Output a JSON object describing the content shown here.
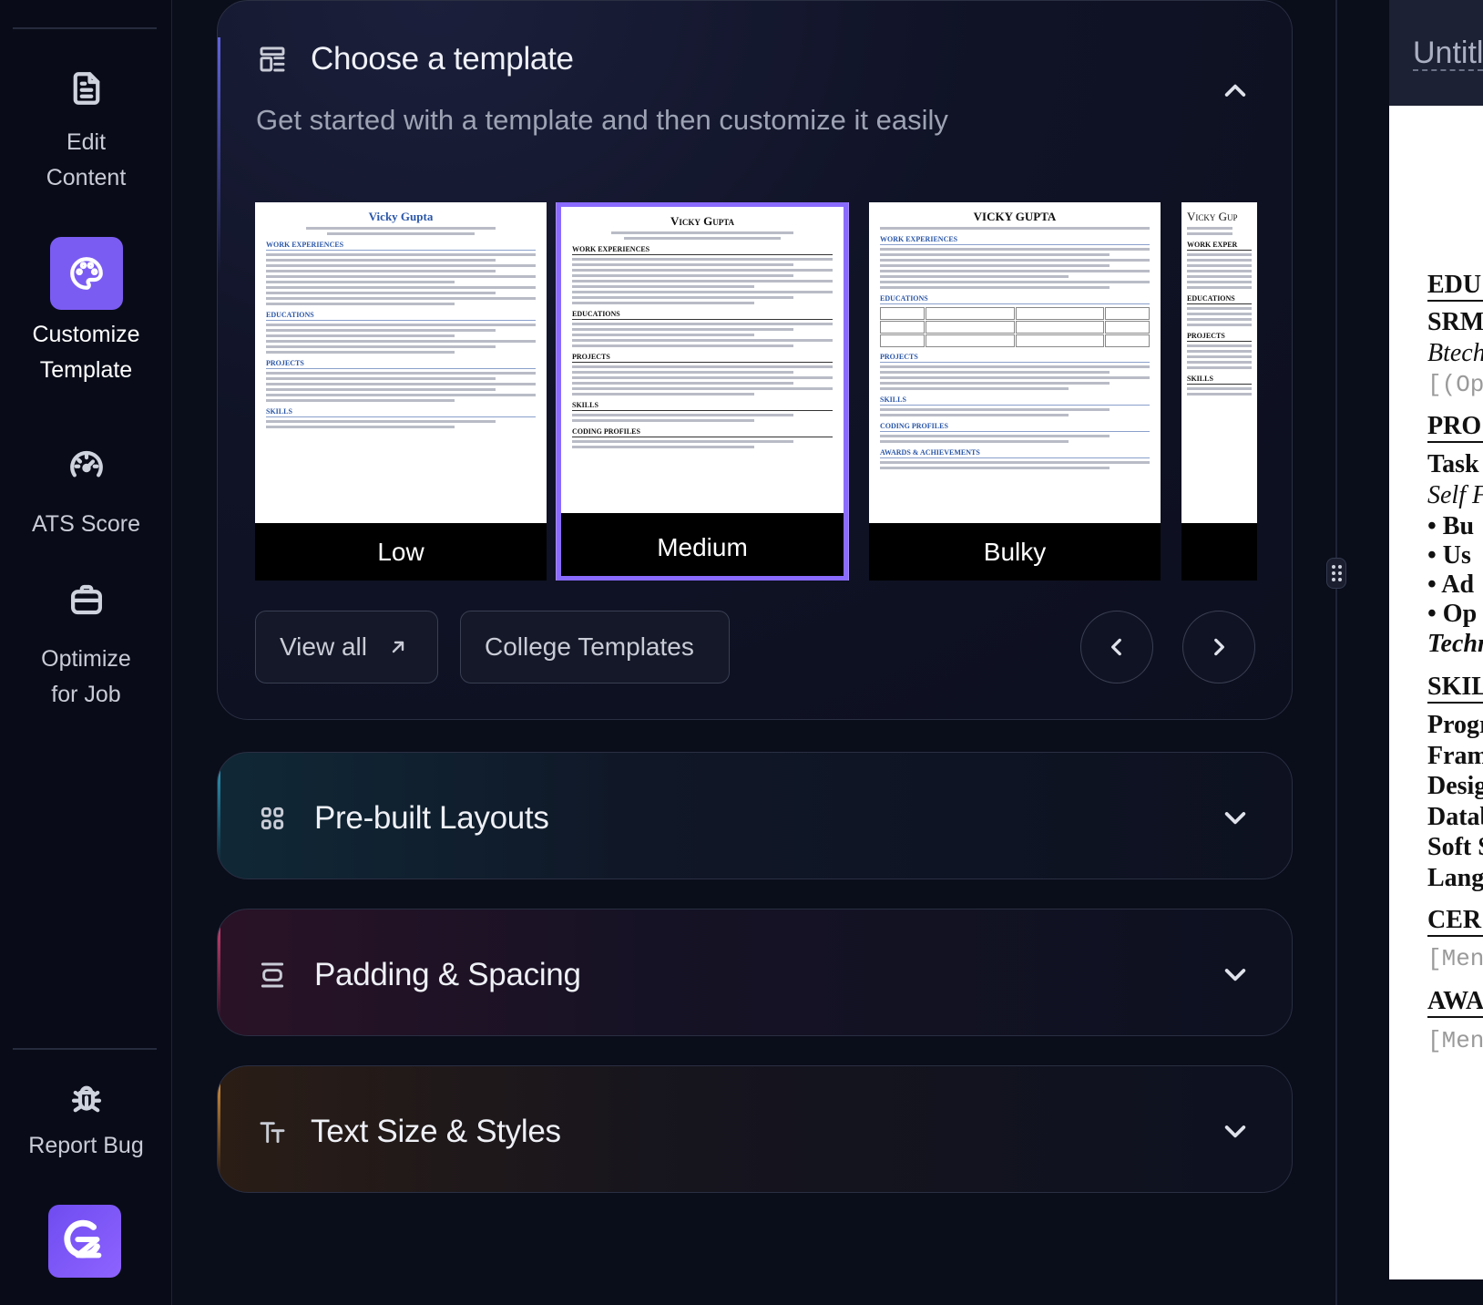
{
  "sidebar": {
    "items": [
      {
        "label": "Edit\nContent",
        "icon": "file-text-icon",
        "active": false
      },
      {
        "label": "Customize\nTemplate",
        "icon": "palette-icon",
        "active": true
      },
      {
        "label": "ATS Score",
        "icon": "gauge-icon",
        "active": false
      },
      {
        "label": "Optimize\nfor Job",
        "icon": "briefcase-icon",
        "active": false
      }
    ],
    "report_bug": "Report Bug",
    "logo_letter": "GZ"
  },
  "templates_panel": {
    "title": "Choose a template",
    "subtitle": "Get started with a template and then customize it easily",
    "cards": [
      {
        "label": "Low",
        "name": "Vicky Gupta",
        "selected": false
      },
      {
        "label": "Medium",
        "name": "Vicky Gupta",
        "selected": true
      },
      {
        "label": "Bulky",
        "name": "VICKY GUPTA",
        "selected": false
      },
      {
        "label": "",
        "name": "Vicky Gup",
        "selected": false
      }
    ],
    "view_all": "View all",
    "college_templates": "College Templates"
  },
  "accordions": [
    {
      "title": "Pre-built Layouts",
      "icon": "grid-icon"
    },
    {
      "title": "Padding & Spacing",
      "icon": "spacing-icon"
    },
    {
      "title": "Text Size & Styles",
      "icon": "text-size-icon"
    }
  ],
  "document": {
    "title": "Untitl",
    "lines": [
      "EDU",
      "SRM",
      "Btech",
      "[(Opt",
      "PRO",
      "Task",
      "Self F",
      "• Bu",
      "• Us",
      "• Ad",
      "• Op",
      "Techn",
      "SKIL",
      "Progr",
      "Fram",
      "Desig",
      "Datab",
      "Soft S",
      "Lang",
      "CER",
      "[Ment",
      "AWA",
      "[Ment"
    ]
  },
  "colors": {
    "accent": "#7b5cf2",
    "background": "#0a0d1a",
    "selected_border": "#8a6bff"
  }
}
